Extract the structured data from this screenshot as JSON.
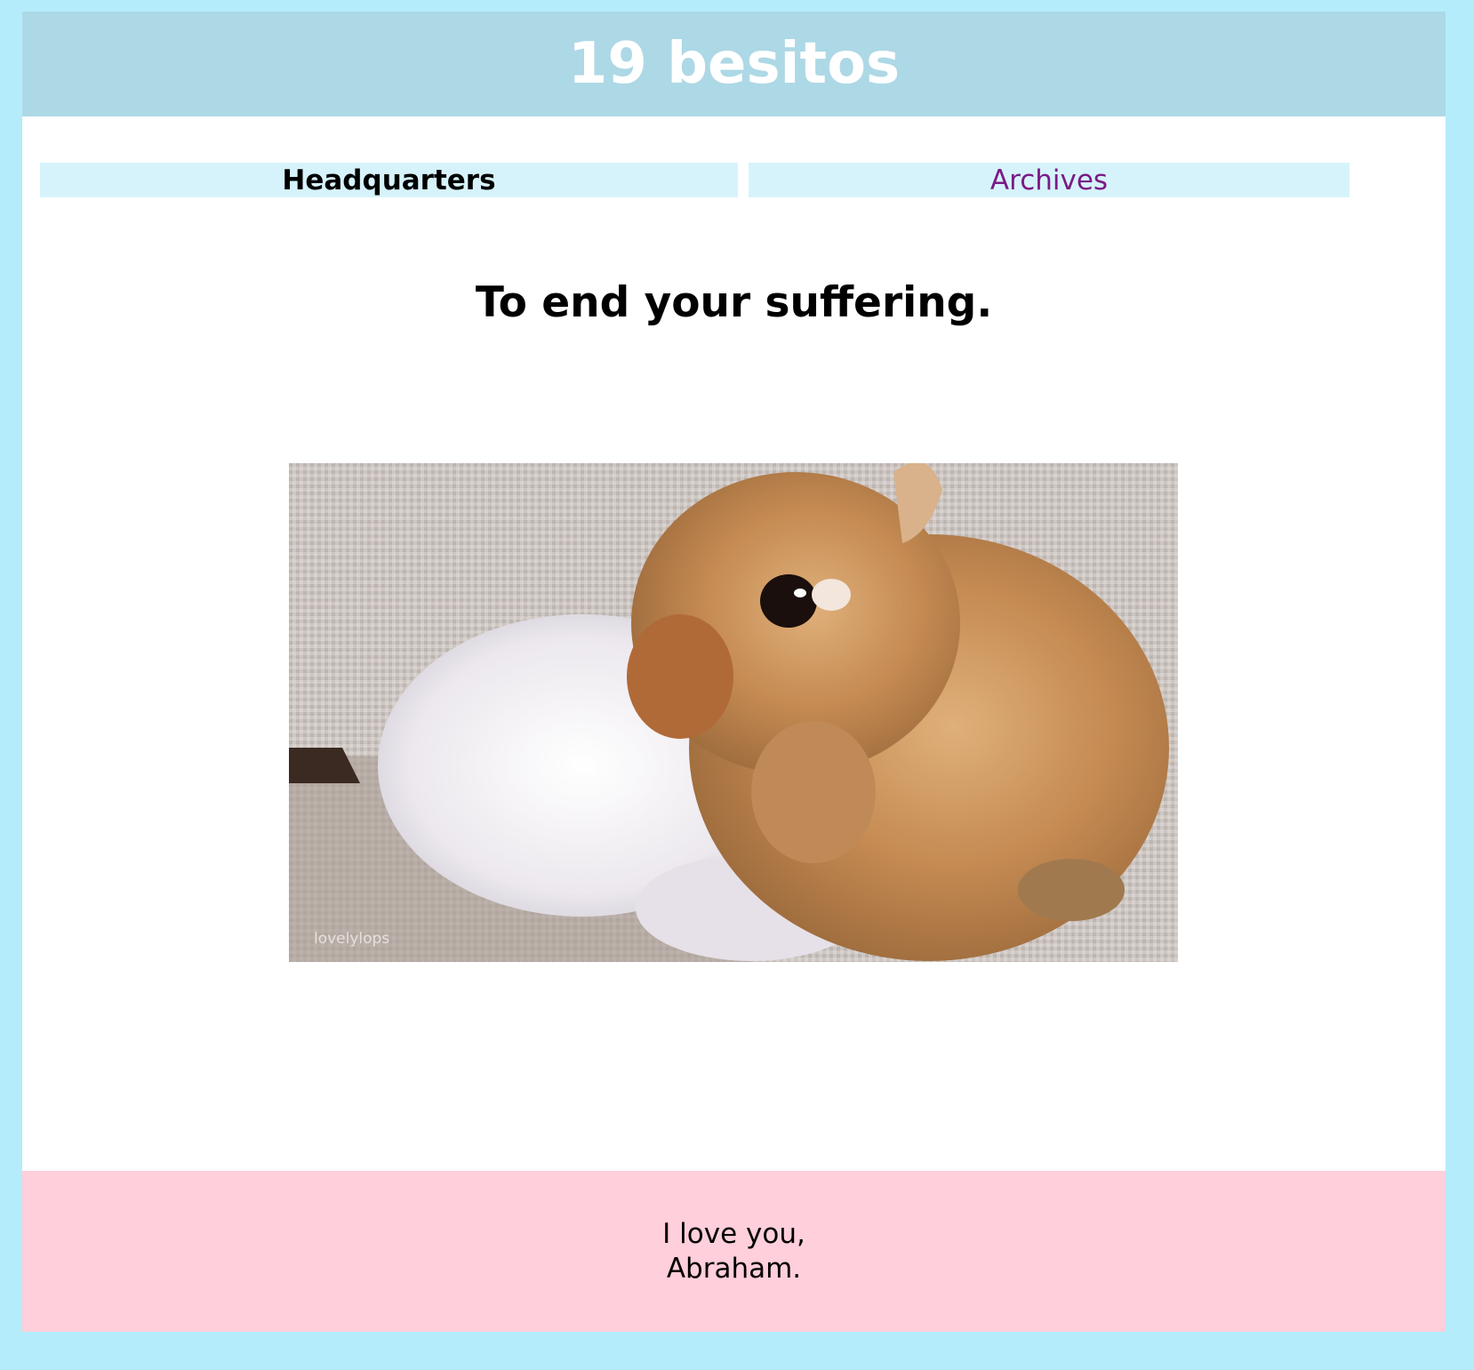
{
  "header": {
    "title": "19 besitos"
  },
  "nav": {
    "items": [
      {
        "label": "Headquarters",
        "active": true
      },
      {
        "label": "Archives",
        "active": false
      }
    ]
  },
  "post": {
    "title": "To end your suffering.",
    "image": {
      "subject": "bunny-photo",
      "watermark": "lovelylops"
    }
  },
  "footer": {
    "line1": "I love you,",
    "line2": "Abraham."
  },
  "colors": {
    "page_bg": "#b4ecfb",
    "header_bg": "#add8e6",
    "nav_bg": "#d6f3fc",
    "link": "#7b1a86",
    "footer_bg": "#ffcfdb"
  }
}
